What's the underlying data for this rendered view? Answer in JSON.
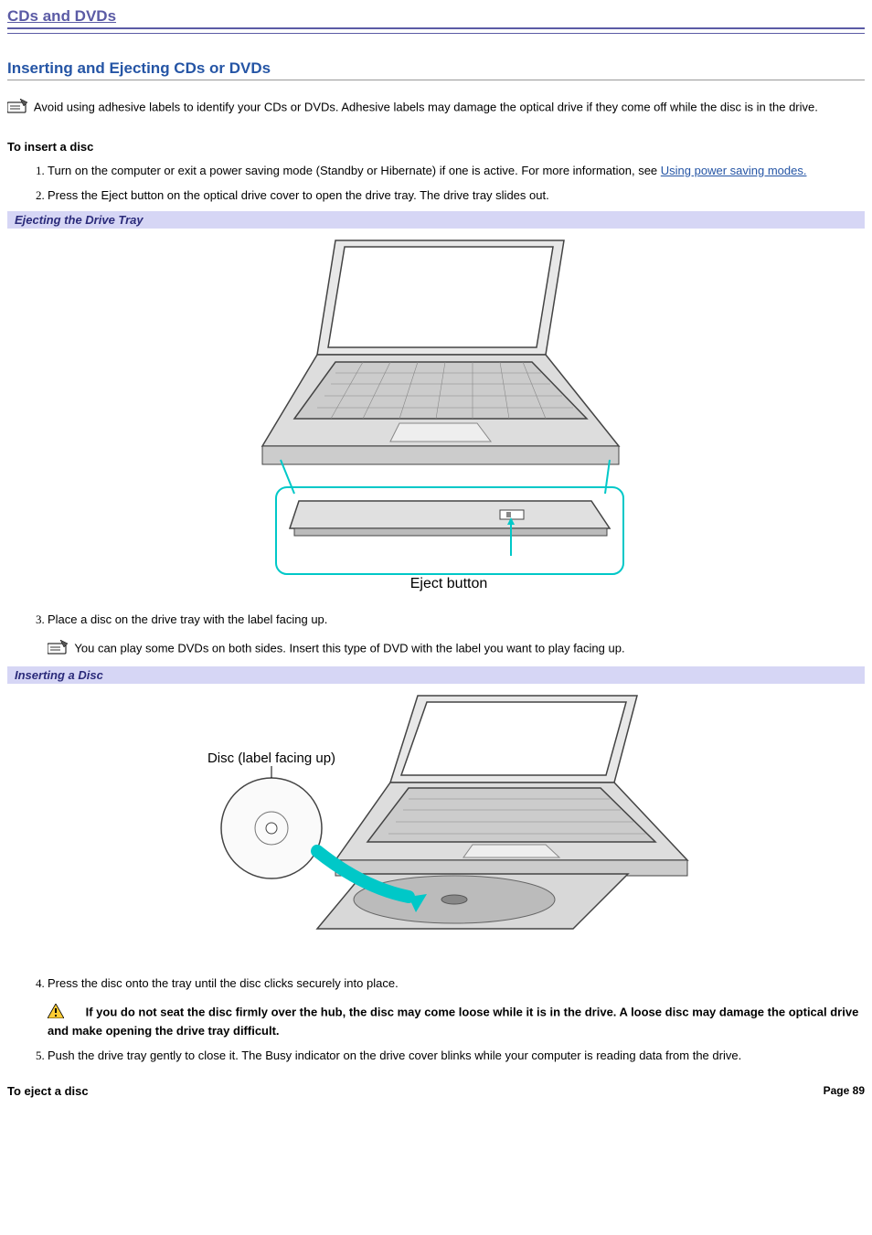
{
  "page_title": "CDs and DVDs",
  "section_heading": "Inserting and Ejecting CDs or DVDs",
  "intro_note": "Avoid using adhesive labels to identify your CDs or DVDs. Adhesive labels may damage the optical drive if they come off while the disc is in the drive.",
  "insert_heading": "To insert a disc",
  "steps": {
    "s1_pre": "Turn on the computer or exit a power saving mode (Standby or Hibernate) if one is active. For more information, see ",
    "s1_link": "Using power saving modes.",
    "s2": "Press the Eject button on the optical drive cover to open the drive tray. The drive tray slides out.",
    "s3": "Place a disc on the drive tray with the label facing up.",
    "s3_note": "You can play some DVDs on both sides. Insert this type of DVD with the label you want to play facing up.",
    "s4": "Press the disc onto the tray until the disc clicks securely into place.",
    "s4_warn": "If you do not seat the disc firmly over the hub, the disc may come loose while it is in the drive. A loose disc may damage the optical drive and make opening the drive tray difficult.",
    "s5": "Push the drive tray gently to close it. The Busy indicator on the drive cover blinks while your computer is reading data from the drive."
  },
  "caption1": "Ejecting the Drive Tray",
  "caption2": "Inserting a Disc",
  "fig1_label": "Eject button",
  "fig2_label": "Disc (label facing up)",
  "eject_heading": "To eject a disc",
  "page_number": "Page 89"
}
